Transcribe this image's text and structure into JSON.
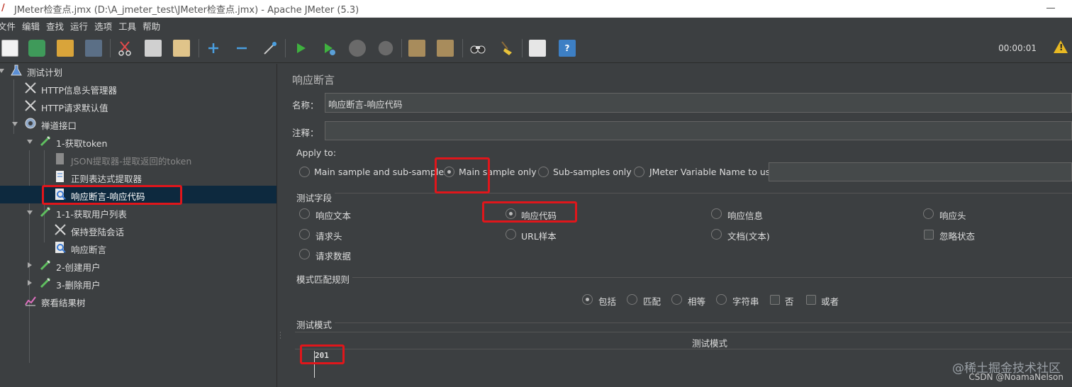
{
  "window": {
    "title": "JMeter检查点.jmx (D:\\A_jmeter_test\\JMeter检查点.jmx) - Apache JMeter (5.3)"
  },
  "menu": [
    "文件",
    "编辑",
    "查找",
    "运行",
    "选项",
    "工具",
    "帮助"
  ],
  "toolbar": {
    "timer": "00:00:01"
  },
  "tree": [
    {
      "label": "测试计划",
      "icon": "flask-icon"
    },
    {
      "label": "HTTP信息头管理器",
      "icon": "wrench-icon"
    },
    {
      "label": "HTTP请求默认值",
      "icon": "wrench-icon"
    },
    {
      "label": "禅道接口",
      "icon": "gear-icon"
    },
    {
      "label": "1-获取token",
      "icon": "pipette-icon"
    },
    {
      "label": "JSON提取器-提取返回的token",
      "icon": "document-icon"
    },
    {
      "label": "正则表达式提取器",
      "icon": "document-icon"
    },
    {
      "label": "响应断言-响应代码",
      "icon": "magnifier-icon"
    },
    {
      "label": "1-1-获取用户列表",
      "icon": "pipette-icon"
    },
    {
      "label": "保持登陆会话",
      "icon": "wrench-icon"
    },
    {
      "label": "响应断言",
      "icon": "magnifier-icon"
    },
    {
      "label": "2-创建用户",
      "icon": "pipette-icon"
    },
    {
      "label": "3-删除用户",
      "icon": "pipette-icon"
    },
    {
      "label": "察看结果树",
      "icon": "chart-icon"
    }
  ],
  "panel": {
    "title": "响应断言",
    "name_label": "名称：",
    "name_value": "响应断言-响应代码",
    "comment_label": "注释：",
    "comment_value": "",
    "apply_to": {
      "label": "Apply to:",
      "options": [
        "Main sample and sub-samples",
        "Main sample only",
        "Sub-samples only",
        "JMeter Variable Name to use"
      ],
      "selected": "Main sample only",
      "variable_value": ""
    },
    "test_field": {
      "label": "测试字段",
      "options": [
        "响应文本",
        "响应代码",
        "响应信息",
        "响应头",
        "请求头",
        "URL样本",
        "文档(文本)",
        "忽略状态",
        "请求数据"
      ],
      "selected": "响应代码"
    },
    "pattern_rules": {
      "label": "模式匹配规则",
      "options": [
        "包括",
        "匹配",
        "相等",
        "字符串",
        "否",
        "或者"
      ],
      "selected": "包括"
    },
    "test_patterns": {
      "label": "测试模式",
      "column_header": "测试模式",
      "rows": [
        "201"
      ]
    }
  },
  "watermark": "@稀土掘金技术社区",
  "credit": "CSDN @NoamaNelson",
  "colors": {
    "background": "#3c3f41",
    "selection": "#0d293e",
    "highlight_box": "#e0161b"
  }
}
